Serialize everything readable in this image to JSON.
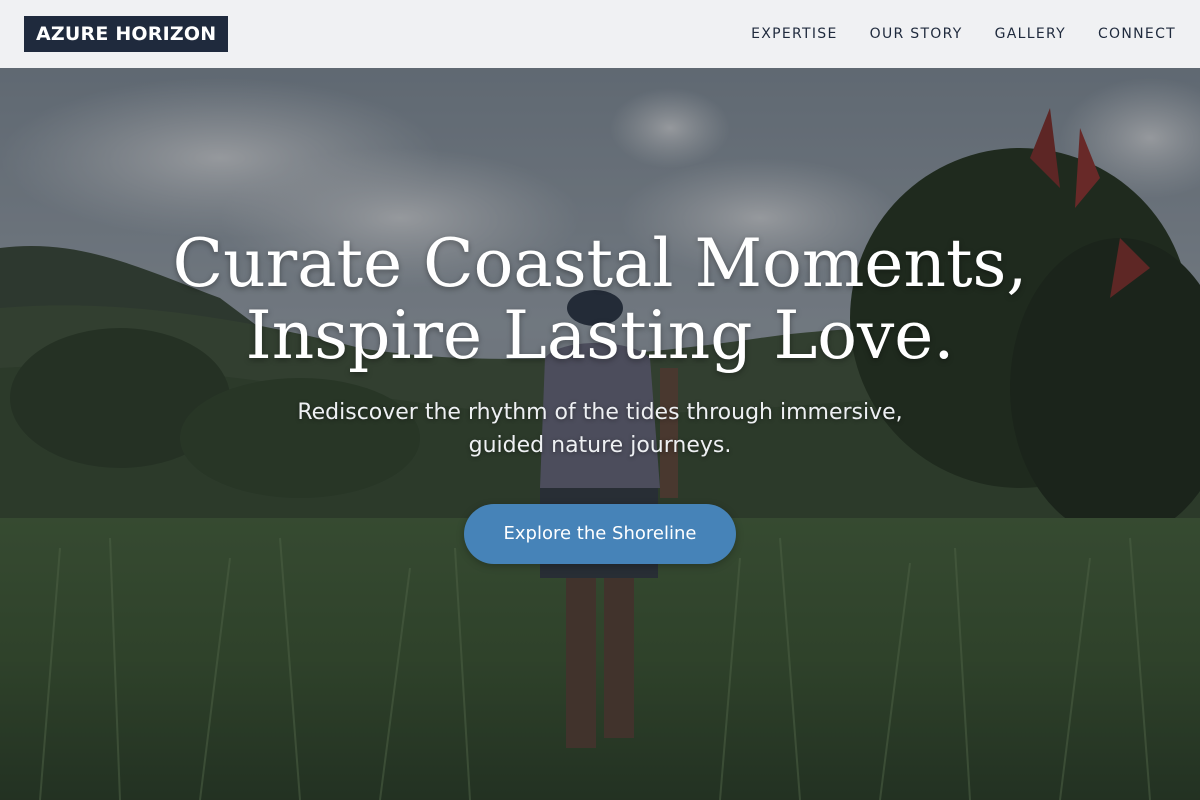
{
  "brand": {
    "logo_text": "AZURE HORIZON",
    "logo_bg_color": "#1f2a3d"
  },
  "nav": {
    "items": [
      {
        "label": "EXPERTISE"
      },
      {
        "label": "OUR STORY"
      },
      {
        "label": "GALLERY"
      },
      {
        "label": "CONNECT"
      }
    ]
  },
  "hero": {
    "title_line_1": "Curate Coastal Moments,",
    "title_line_2": "Inspire Lasting Love.",
    "subtitle_line_1": "Rediscover the rhythm of the tides through immersive,",
    "subtitle_line_2": "guided nature journeys.",
    "cta_label": "Explore the Shoreline",
    "cta_color": "#4683b8",
    "background_image": "photo of a hiker walking through green rice fields with forested hills and cloudy sky"
  }
}
